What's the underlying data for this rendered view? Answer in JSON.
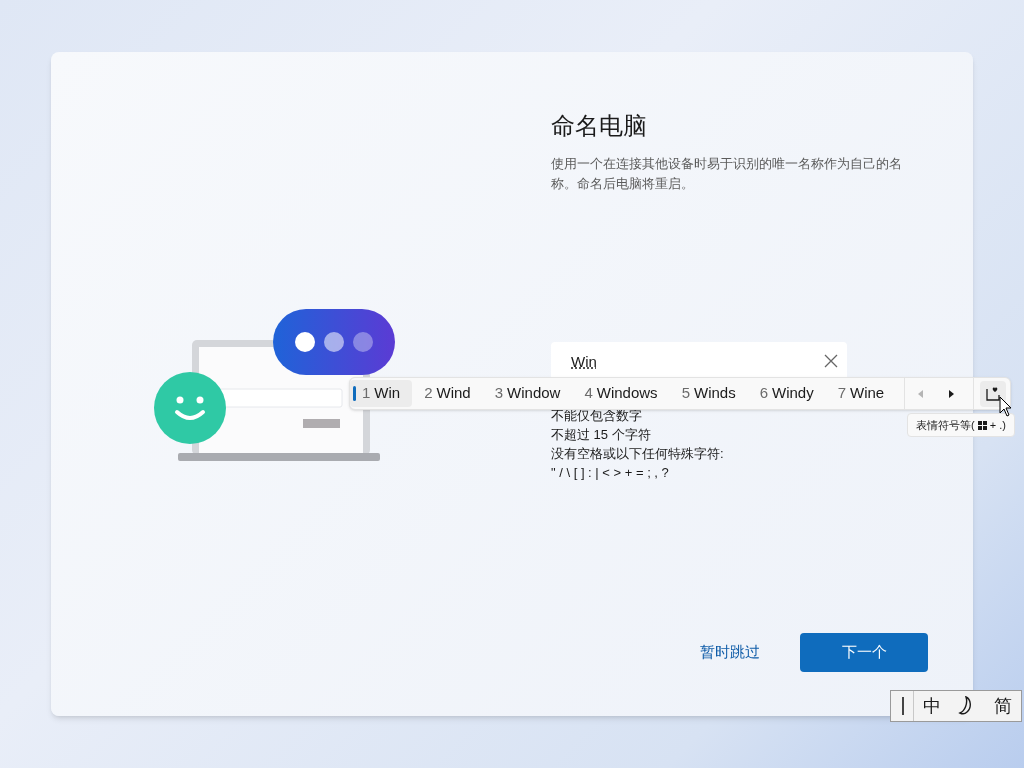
{
  "page": {
    "title": "命名电脑",
    "description": "使用一个在连接其他设备时易于识别的唯一名称作为自己的名称。命名后电脑将重启。"
  },
  "name_field": {
    "value": "Win"
  },
  "rules": [
    "不能仅包含数字",
    "不超过 15 个字符",
    "没有空格或以下任何特殊字符:",
    "\" / \\ [ ] : | < > + = ; , ?"
  ],
  "buttons": {
    "skip": "暂时跳过",
    "next": "下一个"
  },
  "candidates": [
    {
      "number": "1",
      "word": "Win",
      "selected": true
    },
    {
      "number": "2",
      "word": "Wind",
      "selected": false
    },
    {
      "number": "3",
      "word": "Window",
      "selected": false
    },
    {
      "number": "4",
      "word": "Windows",
      "selected": false
    },
    {
      "number": "5",
      "word": "Winds",
      "selected": false
    },
    {
      "number": "6",
      "word": "Windy",
      "selected": false
    },
    {
      "number": "7",
      "word": "Wine",
      "selected": false
    }
  ],
  "candidate_nav": {
    "previous_disabled": true,
    "next_disabled": false
  },
  "emoji_tooltip": "表情符号等(",
  "emoji_tooltip_end": "+ .)",
  "ime_toolbar": {
    "language": "中",
    "script": "简"
  }
}
